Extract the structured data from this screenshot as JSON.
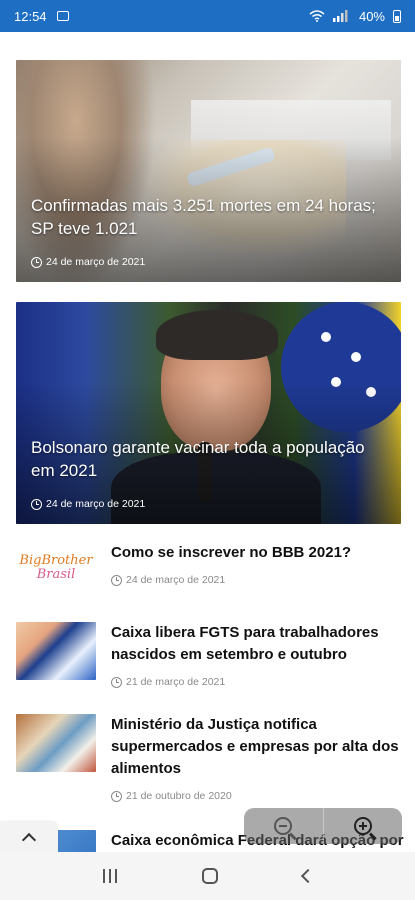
{
  "status_bar": {
    "time": "12:54",
    "battery": "40%"
  },
  "featured": [
    {
      "title": "Confirmadas mais 3.251 mortes em 24 horas; SP teve 1.021",
      "date": "24 de março de 2021"
    },
    {
      "title": "Bolsonaro garante vacinar toda a população em 2021",
      "date": "24 de março de 2021"
    }
  ],
  "articles": [
    {
      "title": "Como se inscrever no BBB 2021?",
      "date": "24 de março de 2021",
      "thumb_text_top": "BigBrother",
      "thumb_text_bottom": "Brasil"
    },
    {
      "title": "Caixa libera FGTS para trabalhadores nascidos em setembro e outubro",
      "date": "21 de março de 2021"
    },
    {
      "title": "Ministério da Justiça notifica supermercados e empresas por alta dos alimentos",
      "date": "21 de outubro de 2020"
    },
    {
      "title": "Caixa econômica Federal dará opção por"
    }
  ],
  "colors": {
    "status_bar": "#1e6fc4",
    "title_text": "#111111",
    "date_text": "#8a8a8a"
  }
}
